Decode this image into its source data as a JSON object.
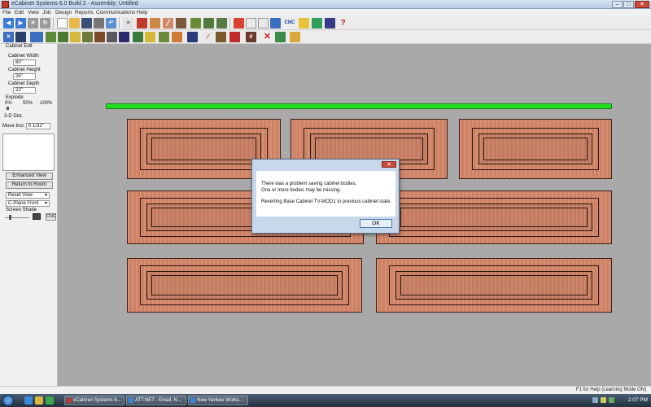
{
  "window": {
    "title": "eCabinet Systems 6.0 Build 2 - Assembly: Untitled",
    "min": "–",
    "max": "□",
    "close": "✕"
  },
  "menu": [
    "File",
    "Edit",
    "View",
    "Job",
    "Design",
    "Reports",
    "Communications",
    "Help"
  ],
  "toolbar": {
    "cnc_label": "CNC",
    "help_icon": "question-icon"
  },
  "left_panel": {
    "heading": "Cabinet Edit",
    "width_label": "Cabinet Width",
    "width_value": "60\"",
    "height_label": "Cabinet Height",
    "height_value": "26\"",
    "depth_label": "Cabinet Depth",
    "depth_value": "22\"",
    "explode_label": "Explode",
    "explode_ticks": [
      "0%",
      "50%",
      "100%"
    ],
    "dist_label": "3-D Dist.",
    "move_label": "Move Incr.",
    "move_value": "0 1/32\"",
    "enhanced_view": "Enhanced View",
    "return_room": "Return to Room",
    "reset_view": "Reset View",
    "cplane": "C-Plane Front",
    "shade_label": "Screen Shade",
    "cnc_btn": "CNC"
  },
  "dialog": {
    "close": "✕",
    "line1": "There was a problem saving cabinet bodies.",
    "line2": "One or more bodies may be missing.",
    "line3": "Reverting Base Cabinet TV-MOD1 to previous cabinet state.",
    "ok": "OK"
  },
  "status": {
    "help": "F1 for Help (Learning Mode ON)"
  },
  "taskbar": {
    "tasks": [
      "eCabinet Systems 6...",
      "ATT.NET - Email, N...",
      "New Yankee Works..."
    ],
    "clock": "2:07 PM"
  },
  "colors": {
    "counter": "#22dd22",
    "wood": "#d5876a",
    "canvas": "#a9a9a9"
  }
}
